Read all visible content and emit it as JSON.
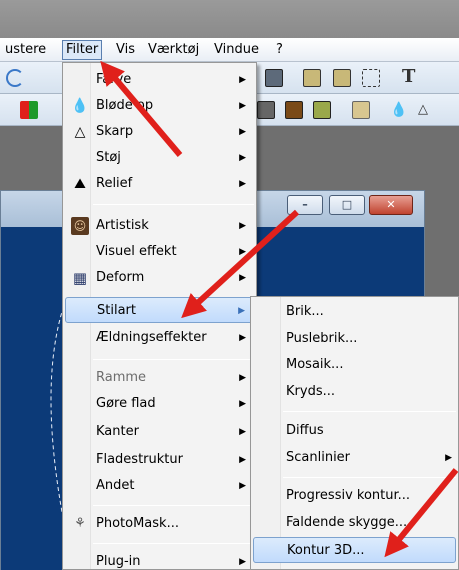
{
  "menubar": {
    "items": [
      "ustere",
      "Filter",
      "Vis",
      "Værktøj",
      "Vindue",
      "?"
    ]
  },
  "filter_menu": {
    "items": [
      {
        "label": "Farve",
        "icon": "",
        "submenu": true
      },
      {
        "label": "Bløde op",
        "icon": "drop-outline-icon",
        "submenu": true
      },
      {
        "label": "Skarp",
        "icon": "triangle-outline-icon",
        "submenu": true
      },
      {
        "label": "Støj",
        "icon": "",
        "submenu": true
      },
      {
        "label": "Relief",
        "icon": "relief-icon",
        "submenu": true
      },
      {
        "label": "Artistisk",
        "icon": "portrait-icon",
        "submenu": true
      },
      {
        "label": "Visuel effekt",
        "icon": "",
        "submenu": true
      },
      {
        "label": "Deform",
        "icon": "grid-icon",
        "submenu": true
      },
      {
        "label": "Stilart",
        "icon": "",
        "submenu": true,
        "highlighted": true
      },
      {
        "label": "Ældningseffekter",
        "icon": "",
        "submenu": true
      },
      {
        "label": "Ramme",
        "icon": "",
        "submenu": true,
        "disabled": true
      },
      {
        "label": "Gøre flad",
        "icon": "",
        "submenu": true
      },
      {
        "label": "Kanter",
        "icon": "",
        "submenu": true
      },
      {
        "label": "Fladestruktur",
        "icon": "",
        "submenu": true
      },
      {
        "label": "Andet",
        "icon": "",
        "submenu": true
      },
      {
        "label": "PhotoMask...",
        "icon": "photomask-icon",
        "submenu": false
      },
      {
        "label": "Plug-in",
        "icon": "",
        "submenu": true
      }
    ]
  },
  "stilart_menu": {
    "items": [
      {
        "label": "Brik...",
        "submenu": false
      },
      {
        "label": "Puslebrik...",
        "submenu": false
      },
      {
        "label": "Mosaik...",
        "submenu": false
      },
      {
        "label": "Kryds...",
        "submenu": false
      },
      {
        "label": "Diffus",
        "submenu": false
      },
      {
        "label": "Scanlinier",
        "submenu": true
      },
      {
        "label": "Progressiv kontur...",
        "submenu": false
      },
      {
        "label": "Faldende skygge...",
        "submenu": false
      },
      {
        "label": "Kontur 3D...",
        "submenu": false,
        "highlighted": true
      }
    ]
  },
  "colors": {
    "highlight": "#c1dbfc",
    "arrow_red": "#e0201b",
    "canvas_blue": "#0c3a78"
  }
}
